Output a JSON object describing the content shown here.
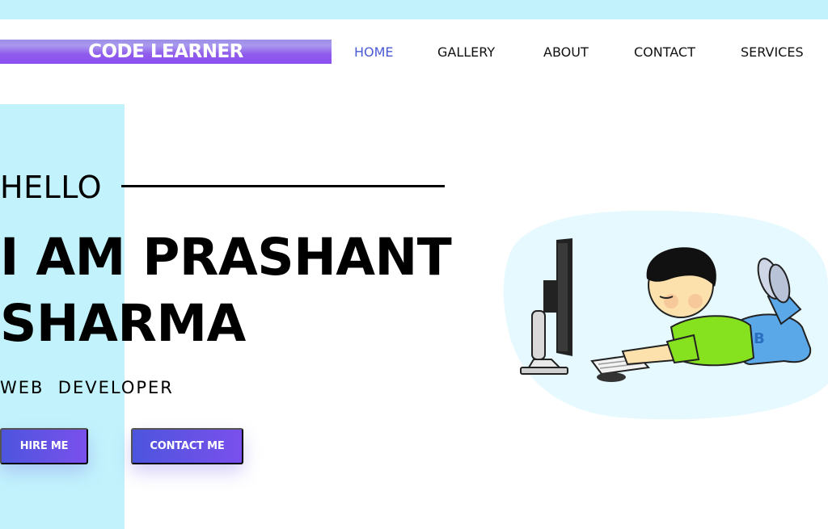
{
  "header": {
    "brand": "CODE LEARNER",
    "nav": [
      {
        "label": "HOME",
        "active": true
      },
      {
        "label": "GALLERY",
        "active": false
      },
      {
        "label": "ABOUT",
        "active": false
      },
      {
        "label": "CONTACT",
        "active": false
      },
      {
        "label": "SERVICES",
        "active": false
      }
    ]
  },
  "hero": {
    "greeting": "HELLO",
    "title_line1": "I AM PRASHANT",
    "title_line2": "SHARMA",
    "subtitle": "WEB  DEVELOPER",
    "buttons": {
      "hire": "HIRE ME",
      "contact": "CONTACT ME"
    },
    "illustration": "boy-coding-at-computer-illustration"
  },
  "colors": {
    "accent_cyan": "#c2f3fc",
    "nav_active": "#4a5ad6",
    "button_start": "#4d55dd",
    "button_end": "#7a50ec",
    "brand_purple": "#8b4ff0"
  }
}
